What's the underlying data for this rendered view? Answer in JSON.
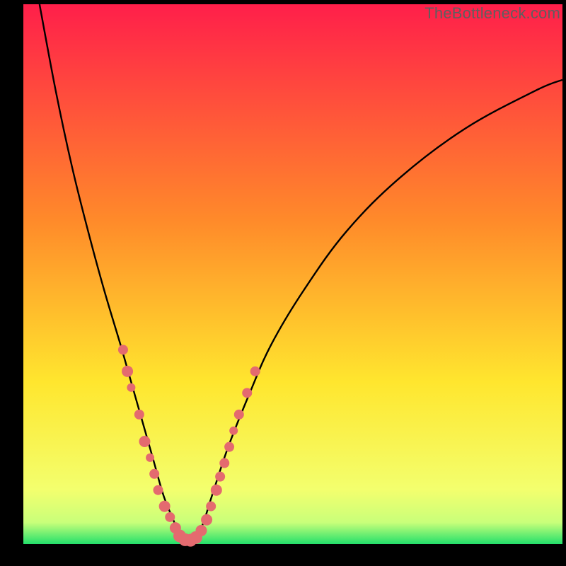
{
  "watermark": "TheBottleneck.com",
  "chart_data": {
    "type": "line",
    "title": "",
    "xlabel": "",
    "ylabel": "",
    "xlim": [
      0,
      100
    ],
    "ylim": [
      0,
      100
    ],
    "gradient": {
      "stops": [
        {
          "pct": 0,
          "color": "#ff1f4a"
        },
        {
          "pct": 40,
          "color": "#ff8a2a"
        },
        {
          "pct": 70,
          "color": "#ffe62e"
        },
        {
          "pct": 90,
          "color": "#f3ff6e"
        },
        {
          "pct": 96,
          "color": "#c9ff7a"
        },
        {
          "pct": 100,
          "color": "#23e06b"
        }
      ]
    },
    "series": [
      {
        "name": "bottleneck-curve",
        "x": [
          3,
          6,
          9,
          12,
          15,
          18,
          20,
          22,
          24,
          26,
          28,
          29,
          30,
          31,
          33,
          35,
          38,
          42,
          46,
          52,
          60,
          70,
          82,
          95,
          100
        ],
        "y": [
          100,
          84,
          70,
          58,
          47,
          37,
          30,
          23,
          16,
          9,
          4,
          1,
          0,
          0.5,
          3,
          9,
          18,
          28,
          37,
          47,
          58,
          68,
          77,
          84,
          86
        ]
      }
    ],
    "scatter": [
      {
        "name": "marker-dots",
        "color": "#e46a6f",
        "points": [
          {
            "x": 18.5,
            "y": 36,
            "r": 7
          },
          {
            "x": 19.3,
            "y": 32,
            "r": 8
          },
          {
            "x": 20.0,
            "y": 29,
            "r": 6
          },
          {
            "x": 21.5,
            "y": 24,
            "r": 7
          },
          {
            "x": 22.5,
            "y": 19,
            "r": 8
          },
          {
            "x": 23.5,
            "y": 16,
            "r": 6
          },
          {
            "x": 24.3,
            "y": 13,
            "r": 7
          },
          {
            "x": 25.0,
            "y": 10,
            "r": 7
          },
          {
            "x": 26.2,
            "y": 7,
            "r": 8
          },
          {
            "x": 27.2,
            "y": 5,
            "r": 7
          },
          {
            "x": 28.2,
            "y": 3,
            "r": 8
          },
          {
            "x": 29.0,
            "y": 1.5,
            "r": 9
          },
          {
            "x": 30.0,
            "y": 0.8,
            "r": 9
          },
          {
            "x": 31.0,
            "y": 0.7,
            "r": 9
          },
          {
            "x": 32.0,
            "y": 1.2,
            "r": 9
          },
          {
            "x": 33.0,
            "y": 2.5,
            "r": 8
          },
          {
            "x": 34.0,
            "y": 4.5,
            "r": 8
          },
          {
            "x": 34.8,
            "y": 7,
            "r": 7
          },
          {
            "x": 35.8,
            "y": 10,
            "r": 8
          },
          {
            "x": 36.5,
            "y": 12.5,
            "r": 7
          },
          {
            "x": 37.3,
            "y": 15,
            "r": 7
          },
          {
            "x": 38.2,
            "y": 18,
            "r": 7
          },
          {
            "x": 39.0,
            "y": 21,
            "r": 6
          },
          {
            "x": 40.0,
            "y": 24,
            "r": 7
          },
          {
            "x": 41.5,
            "y": 28,
            "r": 7
          },
          {
            "x": 43.0,
            "y": 32,
            "r": 7
          }
        ]
      }
    ]
  }
}
